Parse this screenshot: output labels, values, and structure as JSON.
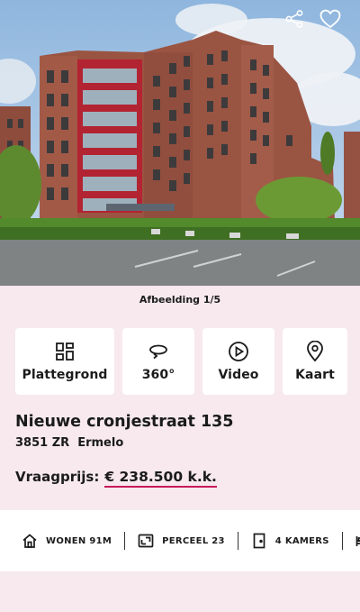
{
  "photo": {
    "counter": "Afbeelding 1/5",
    "actions": [
      {
        "name": "share-icon"
      },
      {
        "name": "heart-icon"
      }
    ]
  },
  "media_tiles": [
    {
      "label": "Plattegrond",
      "icon": "floorplan-icon"
    },
    {
      "label": "360°",
      "icon": "rotate-360-icon"
    },
    {
      "label": "Video",
      "icon": "play-icon"
    },
    {
      "label": "Kaart",
      "icon": "map-pin-icon"
    }
  ],
  "listing": {
    "street": "Nieuwe cronjestraat 135",
    "postal_code": "3851 ZR",
    "city": "Ermelo",
    "price_label": "Vraagprijs:",
    "price_value": "€ 238.500 k.k."
  },
  "features": [
    {
      "icon": "house-icon",
      "label": "WONEN 91M"
    },
    {
      "icon": "plot-icon",
      "label": "PERCEEL 23"
    },
    {
      "icon": "door-icon",
      "label": "4 KAMERS"
    },
    {
      "icon": "bed-icon",
      "label": ""
    }
  ],
  "colors": {
    "background": "#f7e9ee",
    "accent": "#c8195a"
  }
}
